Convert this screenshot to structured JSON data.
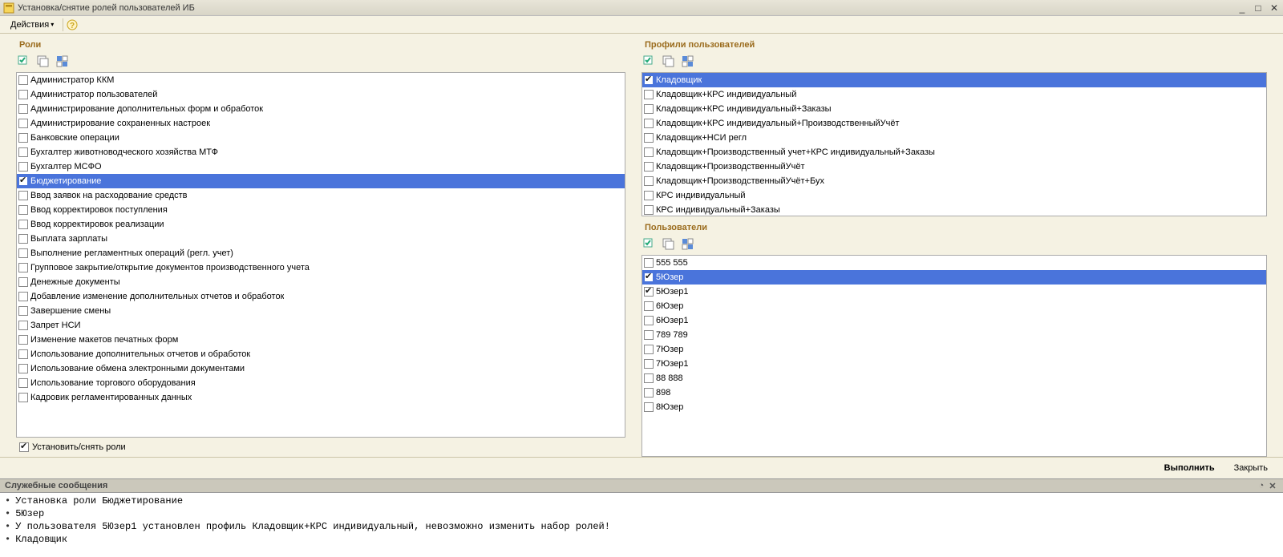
{
  "window": {
    "title": "Установка/снятие ролей пользователей ИБ"
  },
  "toolbar": {
    "actions_label": "Действия"
  },
  "roles": {
    "title": "Роли",
    "items": [
      {
        "label": "Администратор ККМ",
        "checked": false,
        "selected": false
      },
      {
        "label": "Администратор пользователей",
        "checked": false,
        "selected": false
      },
      {
        "label": "Администрирование дополнительных форм и обработок",
        "checked": false,
        "selected": false
      },
      {
        "label": "Администрирование сохраненных настроек",
        "checked": false,
        "selected": false
      },
      {
        "label": "Банковские операции",
        "checked": false,
        "selected": false
      },
      {
        "label": "Бухгалтер животноводческого хозяйства МТФ",
        "checked": false,
        "selected": false
      },
      {
        "label": "Бухгалтер МСФО",
        "checked": false,
        "selected": false
      },
      {
        "label": "Бюджетирование",
        "checked": true,
        "selected": true
      },
      {
        "label": "Ввод заявок на расходование средств",
        "checked": false,
        "selected": false
      },
      {
        "label": "Ввод корректировок поступления",
        "checked": false,
        "selected": false
      },
      {
        "label": "Ввод корректировок реализации",
        "checked": false,
        "selected": false
      },
      {
        "label": "Выплата зарплаты",
        "checked": false,
        "selected": false
      },
      {
        "label": "Выполнение регламентных операций (регл. учет)",
        "checked": false,
        "selected": false
      },
      {
        "label": "Групповое закрытие/открытие документов производственного учета",
        "checked": false,
        "selected": false
      },
      {
        "label": "Денежные документы",
        "checked": false,
        "selected": false
      },
      {
        "label": "Добавление изменение дополнительных отчетов и обработок",
        "checked": false,
        "selected": false
      },
      {
        "label": "Завершение смены",
        "checked": false,
        "selected": false
      },
      {
        "label": "Запрет НСИ",
        "checked": false,
        "selected": false
      },
      {
        "label": "Изменение макетов печатных форм",
        "checked": false,
        "selected": false
      },
      {
        "label": "Использование дополнительных отчетов и обработок",
        "checked": false,
        "selected": false
      },
      {
        "label": "Использование обмена электронными документами",
        "checked": false,
        "selected": false
      },
      {
        "label": "Использование торгового оборудования",
        "checked": false,
        "selected": false
      },
      {
        "label": "Кадровик регламентированных данных",
        "checked": false,
        "selected": false
      }
    ]
  },
  "footer_checkbox_label": "Установить/снять роли",
  "profiles": {
    "title": "Профили пользователей",
    "items": [
      {
        "label": "Кладовщик",
        "checked": true,
        "selected": true
      },
      {
        "label": "Кладовщик+КРС индивидуальный",
        "checked": false,
        "selected": false
      },
      {
        "label": "Кладовщик+КРС индивидуальный+Заказы",
        "checked": false,
        "selected": false
      },
      {
        "label": "Кладовщик+КРС индивидуальный+ПроизводственныйУчёт",
        "checked": false,
        "selected": false
      },
      {
        "label": "Кладовщик+НСИ регл",
        "checked": false,
        "selected": false
      },
      {
        "label": "Кладовщик+Производственный учет+КРС индивидуальный+Заказы",
        "checked": false,
        "selected": false
      },
      {
        "label": "Кладовщик+ПроизводственныйУчёт",
        "checked": false,
        "selected": false
      },
      {
        "label": "Кладовщик+ПроизводственныйУчёт+Бух",
        "checked": false,
        "selected": false
      },
      {
        "label": "КРС индивидуальный",
        "checked": false,
        "selected": false
      },
      {
        "label": "КРС индивидуальный+Заказы",
        "checked": false,
        "selected": false
      }
    ]
  },
  "users": {
    "title": "Пользователи",
    "items": [
      {
        "label": "555 555",
        "checked": false,
        "selected": false
      },
      {
        "label": "5Юзер",
        "checked": true,
        "selected": true
      },
      {
        "label": "5Юзер1",
        "checked": true,
        "selected": false
      },
      {
        "label": "6Юзер",
        "checked": false,
        "selected": false
      },
      {
        "label": "6Юзер1",
        "checked": false,
        "selected": false
      },
      {
        "label": "789 789",
        "checked": false,
        "selected": false
      },
      {
        "label": "7Юзер",
        "checked": false,
        "selected": false
      },
      {
        "label": "7Юзер1",
        "checked": false,
        "selected": false
      },
      {
        "label": "88 888",
        "checked": false,
        "selected": false
      },
      {
        "label": "898",
        "checked": false,
        "selected": false
      },
      {
        "label": "8Юзер",
        "checked": false,
        "selected": false
      }
    ]
  },
  "buttons": {
    "execute": "Выполнить",
    "close": "Закрыть"
  },
  "messages": {
    "title": "Служебные сообщения",
    "lines": [
      "Установка роли Бюджетирование",
      "5Юзер",
      "У пользователя 5Юзер1 установлен профиль Кладовщик+КРС индивидуальный, невозможно изменить набор ролей!",
      "Кладовщик"
    ]
  }
}
